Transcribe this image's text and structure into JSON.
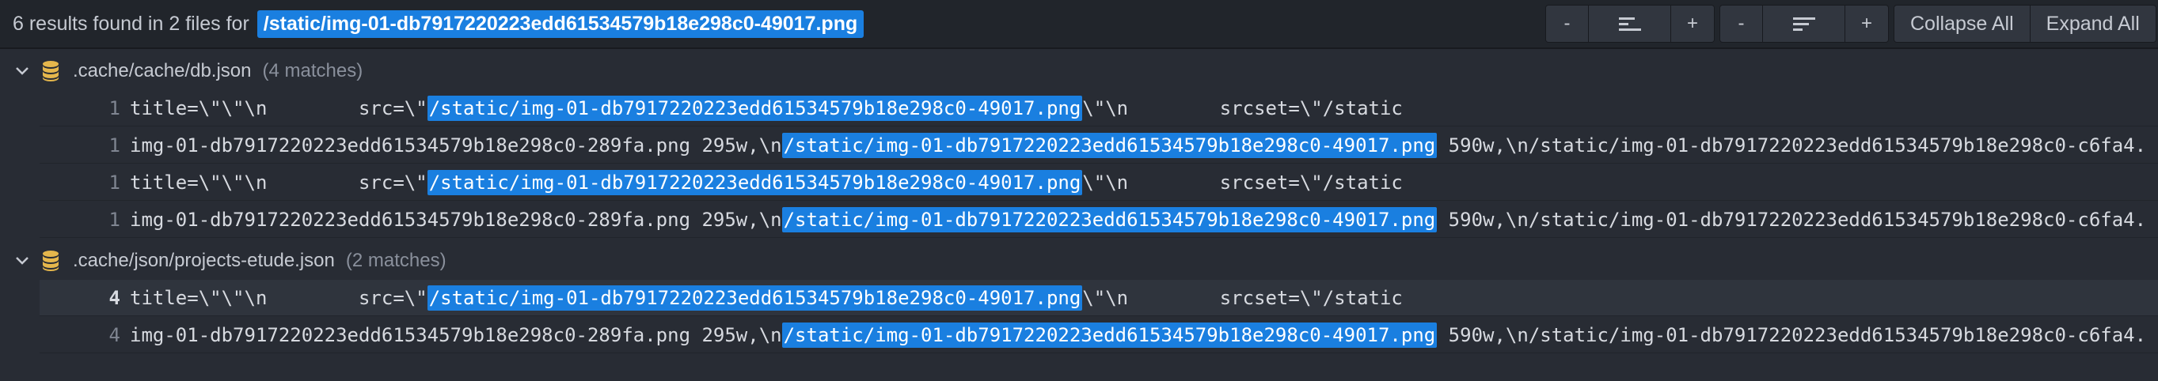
{
  "header": {
    "summary_prefix": "6 results found in 2 files for",
    "query": "/static/img-01-db7917220223edd61534579b18e298c0-49017.png",
    "group1": {
      "minus": "-",
      "plus": "+",
      "icon": "lines-left-icon"
    },
    "group2": {
      "minus": "-",
      "plus": "+",
      "icon": "lines-center-icon"
    },
    "collapse_all": "Collapse All",
    "expand_all": "Expand All"
  },
  "files": [
    {
      "path": ".cache/cache/db.json",
      "matches": "(4 matches)",
      "lines": [
        {
          "num": "1",
          "pre": "title=\\\"\\\"\\n        src=\\\"",
          "hl": "/static/img-01-db7917220223edd61534579b18e298c0-49017.png",
          "post": "\\\"\\n        srcset=\\\"/static"
        },
        {
          "num": "1",
          "pre": "img-01-db7917220223edd61534579b18e298c0-289fa.png 295w,\\n",
          "hl": "/static/img-01-db7917220223edd61534579b18e298c0-49017.png",
          "post": " 590w,\\n/static/img-01-db7917220223edd61534579b18e298c0-c6fa4."
        },
        {
          "num": "1",
          "pre": "title=\\\"\\\"\\n        src=\\\"",
          "hl": "/static/img-01-db7917220223edd61534579b18e298c0-49017.png",
          "post": "\\\"\\n        srcset=\\\"/static"
        },
        {
          "num": "1",
          "pre": "img-01-db7917220223edd61534579b18e298c0-289fa.png 295w,\\n",
          "hl": "/static/img-01-db7917220223edd61534579b18e298c0-49017.png",
          "post": " 590w,\\n/static/img-01-db7917220223edd61534579b18e298c0-c6fa4."
        }
      ]
    },
    {
      "path": ".cache/json/projects-etude.json",
      "matches": "(2 matches)",
      "lines": [
        {
          "num": "4",
          "pre": "title=\\\"\\\"\\n        src=\\\"",
          "hl": "/static/img-01-db7917220223edd61534579b18e298c0-49017.png",
          "post": "\\\"\\n        srcset=\\\"/static"
        },
        {
          "num": "4",
          "pre": "img-01-db7917220223edd61534579b18e298c0-289fa.png 295w,\\n",
          "hl": "/static/img-01-db7917220223edd61534579b18e298c0-49017.png",
          "post": " 590w,\\n/static/img-01-db7917220223edd61534579b18e298c0-c6fa4."
        }
      ]
    }
  ],
  "colors": {
    "background": "#282c34",
    "header_bg": "#21252b",
    "highlight": "#1a7fe0",
    "db_icon": "#e5b74c"
  }
}
